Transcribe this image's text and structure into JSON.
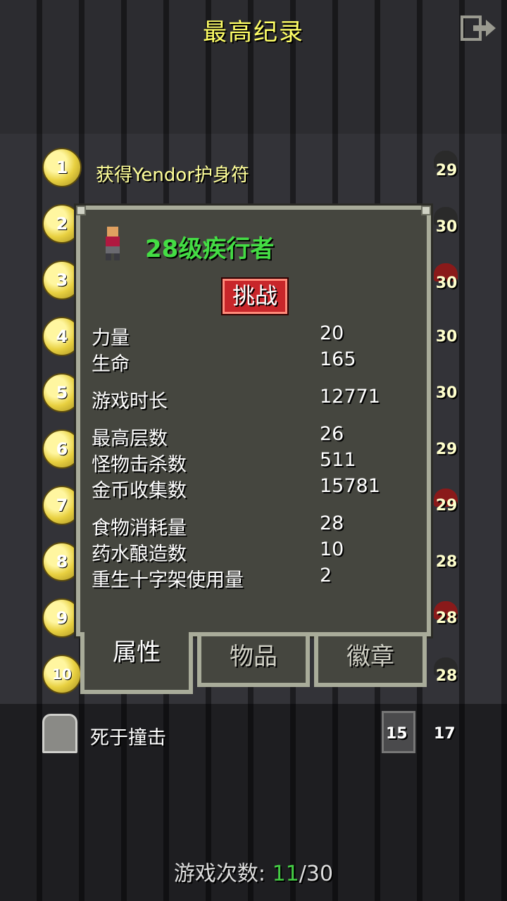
{
  "title": "最高纪录",
  "rankings": [
    {
      "rank": "1",
      "text": "获得Yendor护身符",
      "level": "29",
      "icon": "helmet-icon"
    },
    {
      "rank": "2",
      "text": "",
      "level": "30",
      "icon": "helmet-icon"
    },
    {
      "rank": "3",
      "text": "",
      "level": "30",
      "icon": "red-helmet-icon"
    },
    {
      "rank": "4",
      "text": "",
      "level": "30",
      "icon": "bow-icon"
    },
    {
      "rank": "5",
      "text": "",
      "level": "30",
      "icon": "bow-icon"
    },
    {
      "rank": "6",
      "text": "",
      "level": "29",
      "icon": "bow-icon"
    },
    {
      "rank": "7",
      "text": "",
      "level": "29",
      "icon": "red-helmet-icon"
    },
    {
      "rank": "8",
      "text": "",
      "level": "28",
      "icon": "bow-icon"
    },
    {
      "rank": "9",
      "text": "",
      "level": "28",
      "icon": "red-helmet-icon"
    },
    {
      "rank": "10",
      "text": "",
      "level": "28",
      "icon": "helmet-icon"
    }
  ],
  "dialog": {
    "hero_name": "28级疾行者",
    "challenge_label": "挑战",
    "stats": [
      {
        "label": "力量",
        "value": "20"
      },
      {
        "label": "生命",
        "value": "165"
      },
      {
        "label": "游戏时长",
        "value": "12771"
      },
      {
        "label": "最高层数",
        "value": "26"
      },
      {
        "label": "怪物击杀数",
        "value": "511"
      },
      {
        "label": "金币收集数",
        "value": "15781"
      },
      {
        "label": "食物消耗量",
        "value": "28"
      },
      {
        "label": "药水酿造数",
        "value": "10"
      },
      {
        "label": "重生十字架使用量",
        "value": "2"
      }
    ],
    "tabs": [
      "属性",
      "物品",
      "徽章"
    ]
  },
  "latest": {
    "text": "死于撞击",
    "depth": "15",
    "level": "17"
  },
  "games": {
    "label": "游戏次数:",
    "current": "11",
    "sep": "/",
    "total": "30"
  },
  "colors": {
    "title": "#ffff66",
    "hero_name": "#44dd44",
    "challenge_button": "#c8262a",
    "games_current": "#44cc44"
  }
}
